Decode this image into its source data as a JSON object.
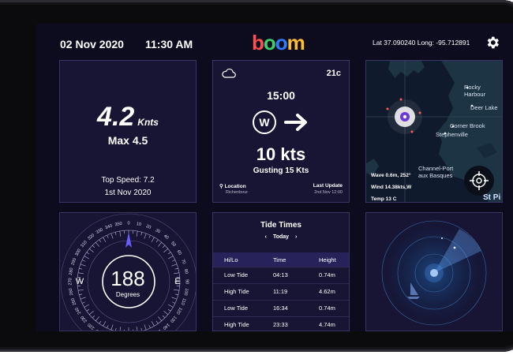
{
  "header": {
    "date": "02 Nov 2020",
    "time": "11:30 AM",
    "logo": [
      "b",
      "o",
      "o",
      "m"
    ],
    "coords": "Lat 37.090240  Long: -95.712891"
  },
  "colors": {
    "background": "#0d0b1e",
    "card": "#181433",
    "accent": "#6a5cff",
    "logo": [
      "#ff4f4f",
      "#3ecf6a",
      "#2f7cff",
      "#ffbf26"
    ]
  },
  "speed": {
    "value": "4.2",
    "unit": "Knts",
    "max": "Max 4.5",
    "top_speed": "Top Speed: 7.2",
    "top_date": "1st Nov 2020"
  },
  "wind": {
    "weather_icon": "cloud-icon",
    "temp": "21c",
    "time": "15:00",
    "direction": "W",
    "speed": "10 kts",
    "gusting": "Gusting 15 Kts",
    "location_label": "Location",
    "location_value": "Richenbour",
    "update_label": "Last Update",
    "update_value": "2nd Nov 12:00"
  },
  "map": {
    "labels": [
      "Rocky Harbour",
      "Deer Lake",
      "Corner Brook",
      "Stephenville",
      "Channel-Port aux Basques",
      "St Pi"
    ],
    "wave": "Wave 0.6m, 252°",
    "wind": "Wind 14.38kts,W",
    "temp": "Temp 13 C"
  },
  "compass": {
    "degrees": "188",
    "label": "Degrees",
    "west": "W",
    "east": "E",
    "ticks": [
      "0",
      "10",
      "20",
      "30",
      "40",
      "50",
      "60",
      "70",
      "80",
      "90",
      "100",
      "110",
      "120",
      "130",
      "140",
      "150",
      "160",
      "170",
      "180",
      "190",
      "200",
      "210",
      "220",
      "230",
      "240",
      "250",
      "260",
      "270",
      "280",
      "290",
      "300",
      "310",
      "320",
      "330",
      "340",
      "350"
    ],
    "heading": 188
  },
  "tides": {
    "title": "Tide Times",
    "day": "Today",
    "prev": "‹",
    "next": "›",
    "headers": [
      "Hi/Lo",
      "Time",
      "Height"
    ],
    "rows": [
      [
        "Low Tide",
        "04:13",
        "0.74m"
      ],
      [
        "High Tide",
        "11:19",
        "4.62m"
      ],
      [
        "Low Tide",
        "16:34",
        "0.74m"
      ],
      [
        "High Tide",
        "23:33",
        "4.74m"
      ]
    ]
  }
}
